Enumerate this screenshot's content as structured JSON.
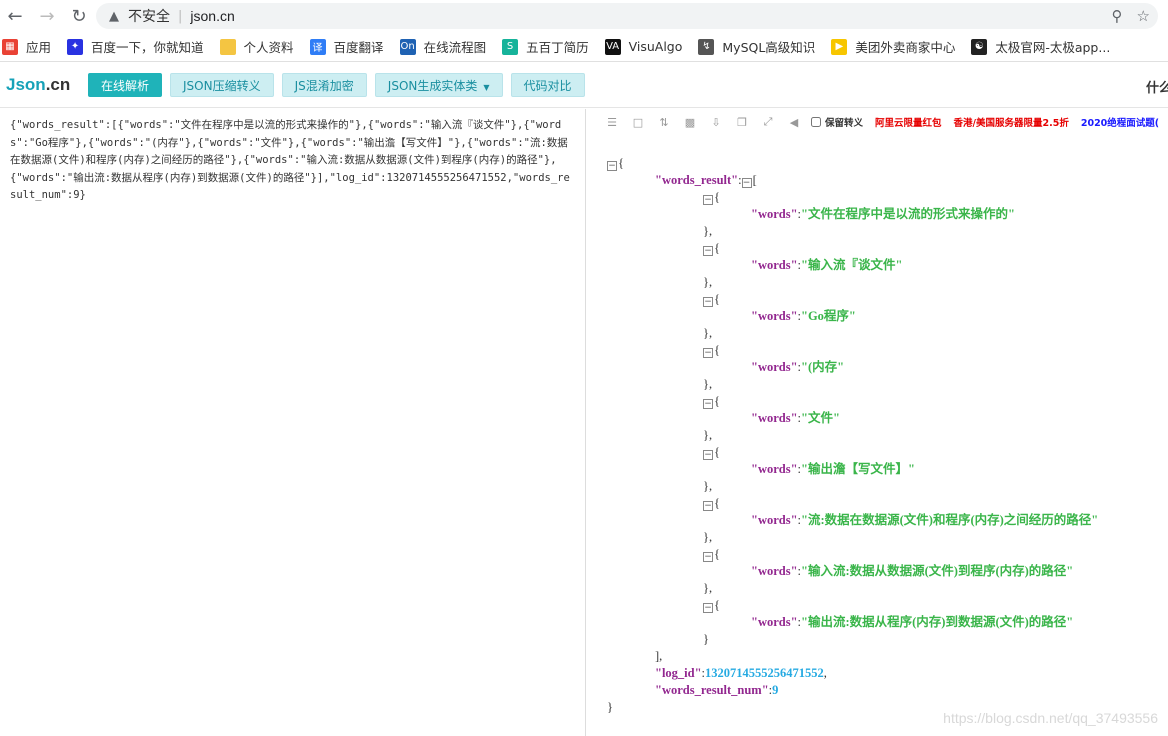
{
  "browser": {
    "security_label": "不安全",
    "url": "json.cn",
    "bookmarks": [
      {
        "label": "应用",
        "icon": "apps-grid-icon",
        "color": "#e94235"
      },
      {
        "label": "百度一下，你就知道",
        "icon": "baidu-paw-icon",
        "color": "#2932e1"
      },
      {
        "label": "个人资料",
        "icon": "folder-icon",
        "color": "#f4c542"
      },
      {
        "label": "百度翻译",
        "icon": "translate-icon",
        "color": "#2f7df6"
      },
      {
        "label": "在线流程图",
        "icon": "on-icon",
        "color": "#1f62b3"
      },
      {
        "label": "五百丁简历",
        "icon": "resume-icon",
        "color": "#16b39a"
      },
      {
        "label": "VisuAlgo",
        "icon": "visualgo-icon",
        "color": "#111111"
      },
      {
        "label": "MySQL高级知识",
        "icon": "mysql-icon",
        "color": "#555555"
      },
      {
        "label": "美团外卖商家中心",
        "icon": "meituan-icon",
        "color": "#f7c600"
      },
      {
        "label": "太极官网-太极app...",
        "icon": "taiji-icon",
        "color": "#222222"
      }
    ]
  },
  "site": {
    "logo_main": "Json",
    "logo_suffix": ".cn",
    "nav": [
      {
        "label": "在线解析",
        "primary": true
      },
      {
        "label": "JSON压缩转义",
        "primary": false
      },
      {
        "label": "JS混淆加密",
        "primary": false
      },
      {
        "label": "JSON生成实体类",
        "primary": false,
        "dropdown": true
      },
      {
        "label": "代码对比",
        "primary": false
      }
    ],
    "right_text": "什么"
  },
  "editor": {
    "raw": "{\"words_result\":[{\"words\":\"文件在程序中是以流的形式来操作的\"},{\"words\":\"输入流『谈文件\"},{\"words\":\"Go程序\"},{\"words\":\"(内存\"},{\"words\":\"文件\"},{\"words\":\"输出澹【写文件】\"},{\"words\":\"流:数据在数据源(文件)和程序(内存)之间经历的路径\"},{\"words\":\"输入流:数据从数据源(文件)到程序(内存)的路径\"},{\"words\":\"输出流:数据从程序(内存)到数据源(文件)的路径\"}],\"log_id\":1320714555256471552,\"words_result_num\":9}"
  },
  "viewer": {
    "toolbar": {
      "escape_label": "保留转义",
      "promos": [
        {
          "text": "阿里云限量红包",
          "color": "#e60000"
        },
        {
          "text": "香港/美国服务器限量2.5折",
          "color": "#e60000"
        },
        {
          "text": "2020绝程面试题(",
          "color": "#1a1aff"
        }
      ]
    },
    "key_words_result": "\"words_result\"",
    "key_words": "\"words\"",
    "key_log_id": "\"log_id\"",
    "key_num": "\"words_result_num\"",
    "log_id": "1320714555256471552",
    "words_result_num": "9",
    "items": [
      "\"文件在程序中是以流的形式来操作的\"",
      "\"输入流『谈文件\"",
      "\"Go程序\"",
      "\"(内存\"",
      "\"文件\"",
      "\"输出澹【写文件】\"",
      "\"流:数据在数据源(文件)和程序(内存)之间经历的路径\"",
      "\"输入流:数据从数据源(文件)到程序(内存)的路径\"",
      "\"输出流:数据从程序(内存)到数据源(文件)的路径\""
    ]
  },
  "watermark": "https://blog.csdn.net/qq_37493556"
}
